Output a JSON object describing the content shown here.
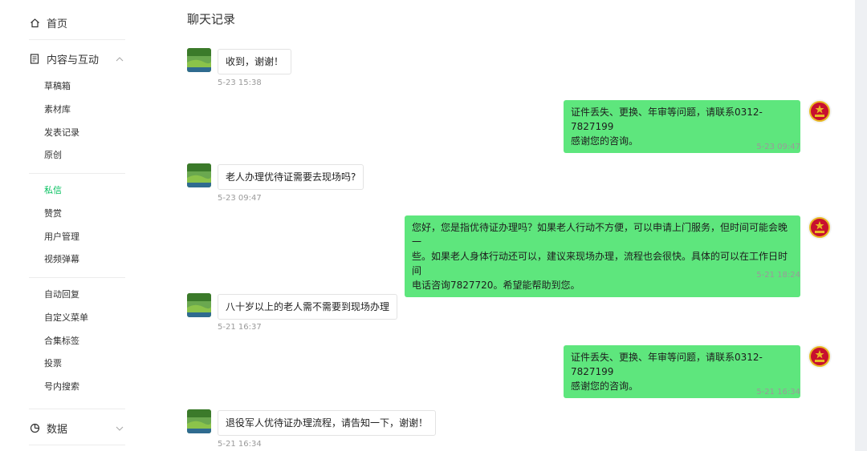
{
  "sidebar": {
    "home": "首页",
    "content": "内容与互动",
    "items": [
      {
        "label": "草稿箱"
      },
      {
        "label": "素材库"
      },
      {
        "label": "发表记录"
      },
      {
        "label": "原创"
      },
      {
        "label": "私信"
      },
      {
        "label": "赞赏"
      },
      {
        "label": "用户管理"
      },
      {
        "label": "视频弹幕"
      },
      {
        "label": "自动回复"
      },
      {
        "label": "自定义菜单"
      },
      {
        "label": "合集标签"
      },
      {
        "label": "投票"
      },
      {
        "label": "号内搜索"
      }
    ],
    "active_item": "私信",
    "data": "数据"
  },
  "chat": {
    "title": "聊天记录",
    "messages": [
      {
        "direction": "in",
        "text": "收到，谢谢！",
        "time": "5-23 15:38"
      },
      {
        "direction": "out",
        "line1": "证件丢失、更换、年审等问题，请联系0312-7827199",
        "line2": "感谢您的咨询。",
        "time": "5-23 09:47"
      },
      {
        "direction": "in",
        "text": "老人办理优待证需要去现场吗?",
        "time": "5-23 09:47"
      },
      {
        "direction": "out",
        "line1": "您好，您是指优待证办理吗？如果老人行动不方便，可以申请上门服务，但时间可能会晚一",
        "line2": "些。如果老人身体行动还可以，建议来现场办理，流程也会很快。具体的可以在工作日时间",
        "line3": "电话咨询7827720。希望能帮助到您。",
        "time": "5-21 18:24"
      },
      {
        "direction": "in",
        "text": "八十岁以上的老人需不需要到现场办理",
        "time": "5-21 16:37"
      },
      {
        "direction": "out",
        "line1": "证件丢失、更换、年审等问题，请联系0312-7827199",
        "line2": "感谢您的咨询。",
        "time": "5-21 16:34"
      },
      {
        "direction": "in",
        "text": "退役军人优待证办理流程，请告知一下，谢谢！",
        "time": "5-21 16:34"
      }
    ]
  },
  "colors": {
    "accent": "#07c160",
    "out_bubble": "#5ee67d",
    "emblem_red": "#c8102e",
    "emblem_gold": "#e8b923"
  }
}
